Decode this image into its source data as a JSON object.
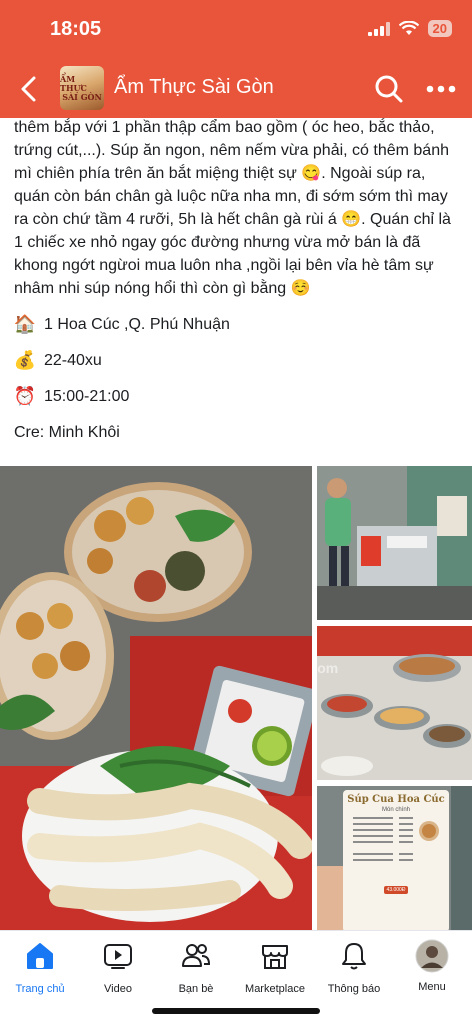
{
  "status_bar": {
    "time": "18:05",
    "battery": "20"
  },
  "header": {
    "page_name": "Ẩm Thực Sài Gòn",
    "logo_text_top": "ẨM THỰC",
    "logo_text_bottom": "SÀI GÒN",
    "accent": "#e8553a"
  },
  "post": {
    "text": "thêm bắp với 1 phần thập cẩm bao gồm ( óc heo, bắc thảo, trứng cút,...). Súp ăn ngon, nêm nếm vừa phải, có thêm bánh mì chiên phía trên ăn bắt miệng thiệt sự 😋. Ngoài súp ra, quán còn bán chân gà luộc nữa nha mn, đi sớm sớm thì may ra còn chứ tầm 4 rưỡi, 5h là hết chân gà rùi á 😁. Quán chỉ là 1 chiếc xe nhỏ ngay góc đường nhưng vừa mở bán là đã khong ngớt ngừoi mua luôn nha ,ngồi lại bên vỉa hè tâm sự nhâm nhi súp nóng hổi thì còn gì bằng ☺️",
    "address_emoji": "🏠",
    "address": "1 Hoa Cúc ,Q. Phú Nhuận",
    "price_emoji": "💰",
    "price": "22-40xu",
    "hours_emoji": "⏰",
    "hours": "15:00-21:00",
    "credit": "Cre: Minh Khôi"
  },
  "photos": {
    "watermark": "SoSanhNha.com",
    "menu_card_title": "Súp Cua Hoa Cúc",
    "menu_card_sub": "Món chính",
    "menu_card_price": "43.000Đ"
  },
  "bottom_nav": {
    "items": [
      {
        "label": "Trang chủ",
        "icon": "home-icon"
      },
      {
        "label": "Video",
        "icon": "video-icon"
      },
      {
        "label": "Bạn bè",
        "icon": "friends-icon"
      },
      {
        "label": "Marketplace",
        "icon": "marketplace-icon"
      },
      {
        "label": "Thông báo",
        "icon": "bell-icon"
      },
      {
        "label": "Menu",
        "icon": "avatar-menu-icon"
      }
    ],
    "active_color": "#1877f2"
  }
}
